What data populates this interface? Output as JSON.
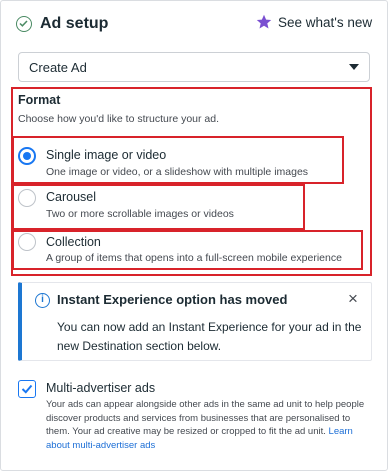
{
  "header": {
    "title": "Ad setup",
    "whats_new": "See what's new"
  },
  "dropdown": {
    "value": "Create Ad"
  },
  "format": {
    "heading": "Format",
    "subheading": "Choose how you'd like to structure your ad.",
    "options": [
      {
        "title": "Single image or video",
        "description": "One image or video, or a slideshow with multiple images",
        "selected": true
      },
      {
        "title": "Carousel",
        "description": "Two or more scrollable images or videos",
        "selected": false
      },
      {
        "title": "Collection",
        "description": "A group of items that opens into a full-screen mobile experience",
        "selected": false
      }
    ]
  },
  "info_box": {
    "icon": "info-icon",
    "title": "Instant Experience option has moved",
    "body": "You can now add an Instant Experience for your ad in the new Destination section below.",
    "close": "×"
  },
  "multi_advertiser": {
    "checked": true,
    "title": "Multi-advertiser ads",
    "body": "Your ads can appear alongside other ads in the same ad unit to help people discover products and services from businesses that are personalised to them. Your ad creative may be resized or cropped to fit the ad unit.",
    "link": "Learn about multi-advertiser ads"
  },
  "colors": {
    "accent": "#1877f2",
    "annotation_red": "#d8232a",
    "check_green": "#4a8a63",
    "star_purple": "#7a4fd1"
  }
}
